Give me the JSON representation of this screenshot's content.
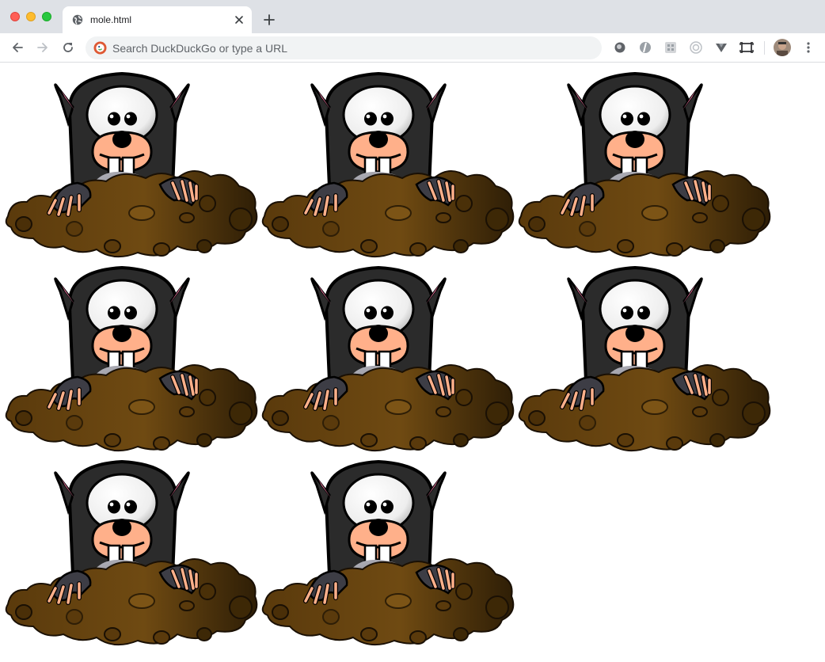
{
  "window": {
    "controls": [
      "close",
      "minimize",
      "maximize"
    ]
  },
  "tab": {
    "title": "mole.html",
    "favicon": "globe-icon",
    "close_icon": "close-icon"
  },
  "toolbar": {
    "back_icon": "arrow-left-icon",
    "forward_icon": "arrow-right-icon",
    "reload_icon": "reload-icon",
    "search_engine_icon": "duckduckgo-icon",
    "omnibox_placeholder": "Search DuckDuckGo or type a URL",
    "extensions": [
      "extension-circle-icon",
      "extension-shield-icon",
      "extension-grid-icon",
      "extension-target-icon",
      "extension-v-icon",
      "screenshot-icon"
    ],
    "menu_icon": "more-vertical-icon"
  },
  "content": {
    "moles": [
      {
        "label": "mole-1"
      },
      {
        "label": "mole-2"
      },
      {
        "label": "mole-3"
      },
      {
        "label": "mole-4"
      },
      {
        "label": "mole-5"
      },
      {
        "label": "mole-6"
      },
      {
        "label": "mole-7"
      },
      {
        "label": "mole-8"
      }
    ]
  },
  "colors": {
    "tabstrip": "#dee1e6",
    "omnibox": "#f1f3f4",
    "mole_fur": "#2b2b2b",
    "mole_face": "#ffb08a",
    "dirt": "#6b4510"
  }
}
